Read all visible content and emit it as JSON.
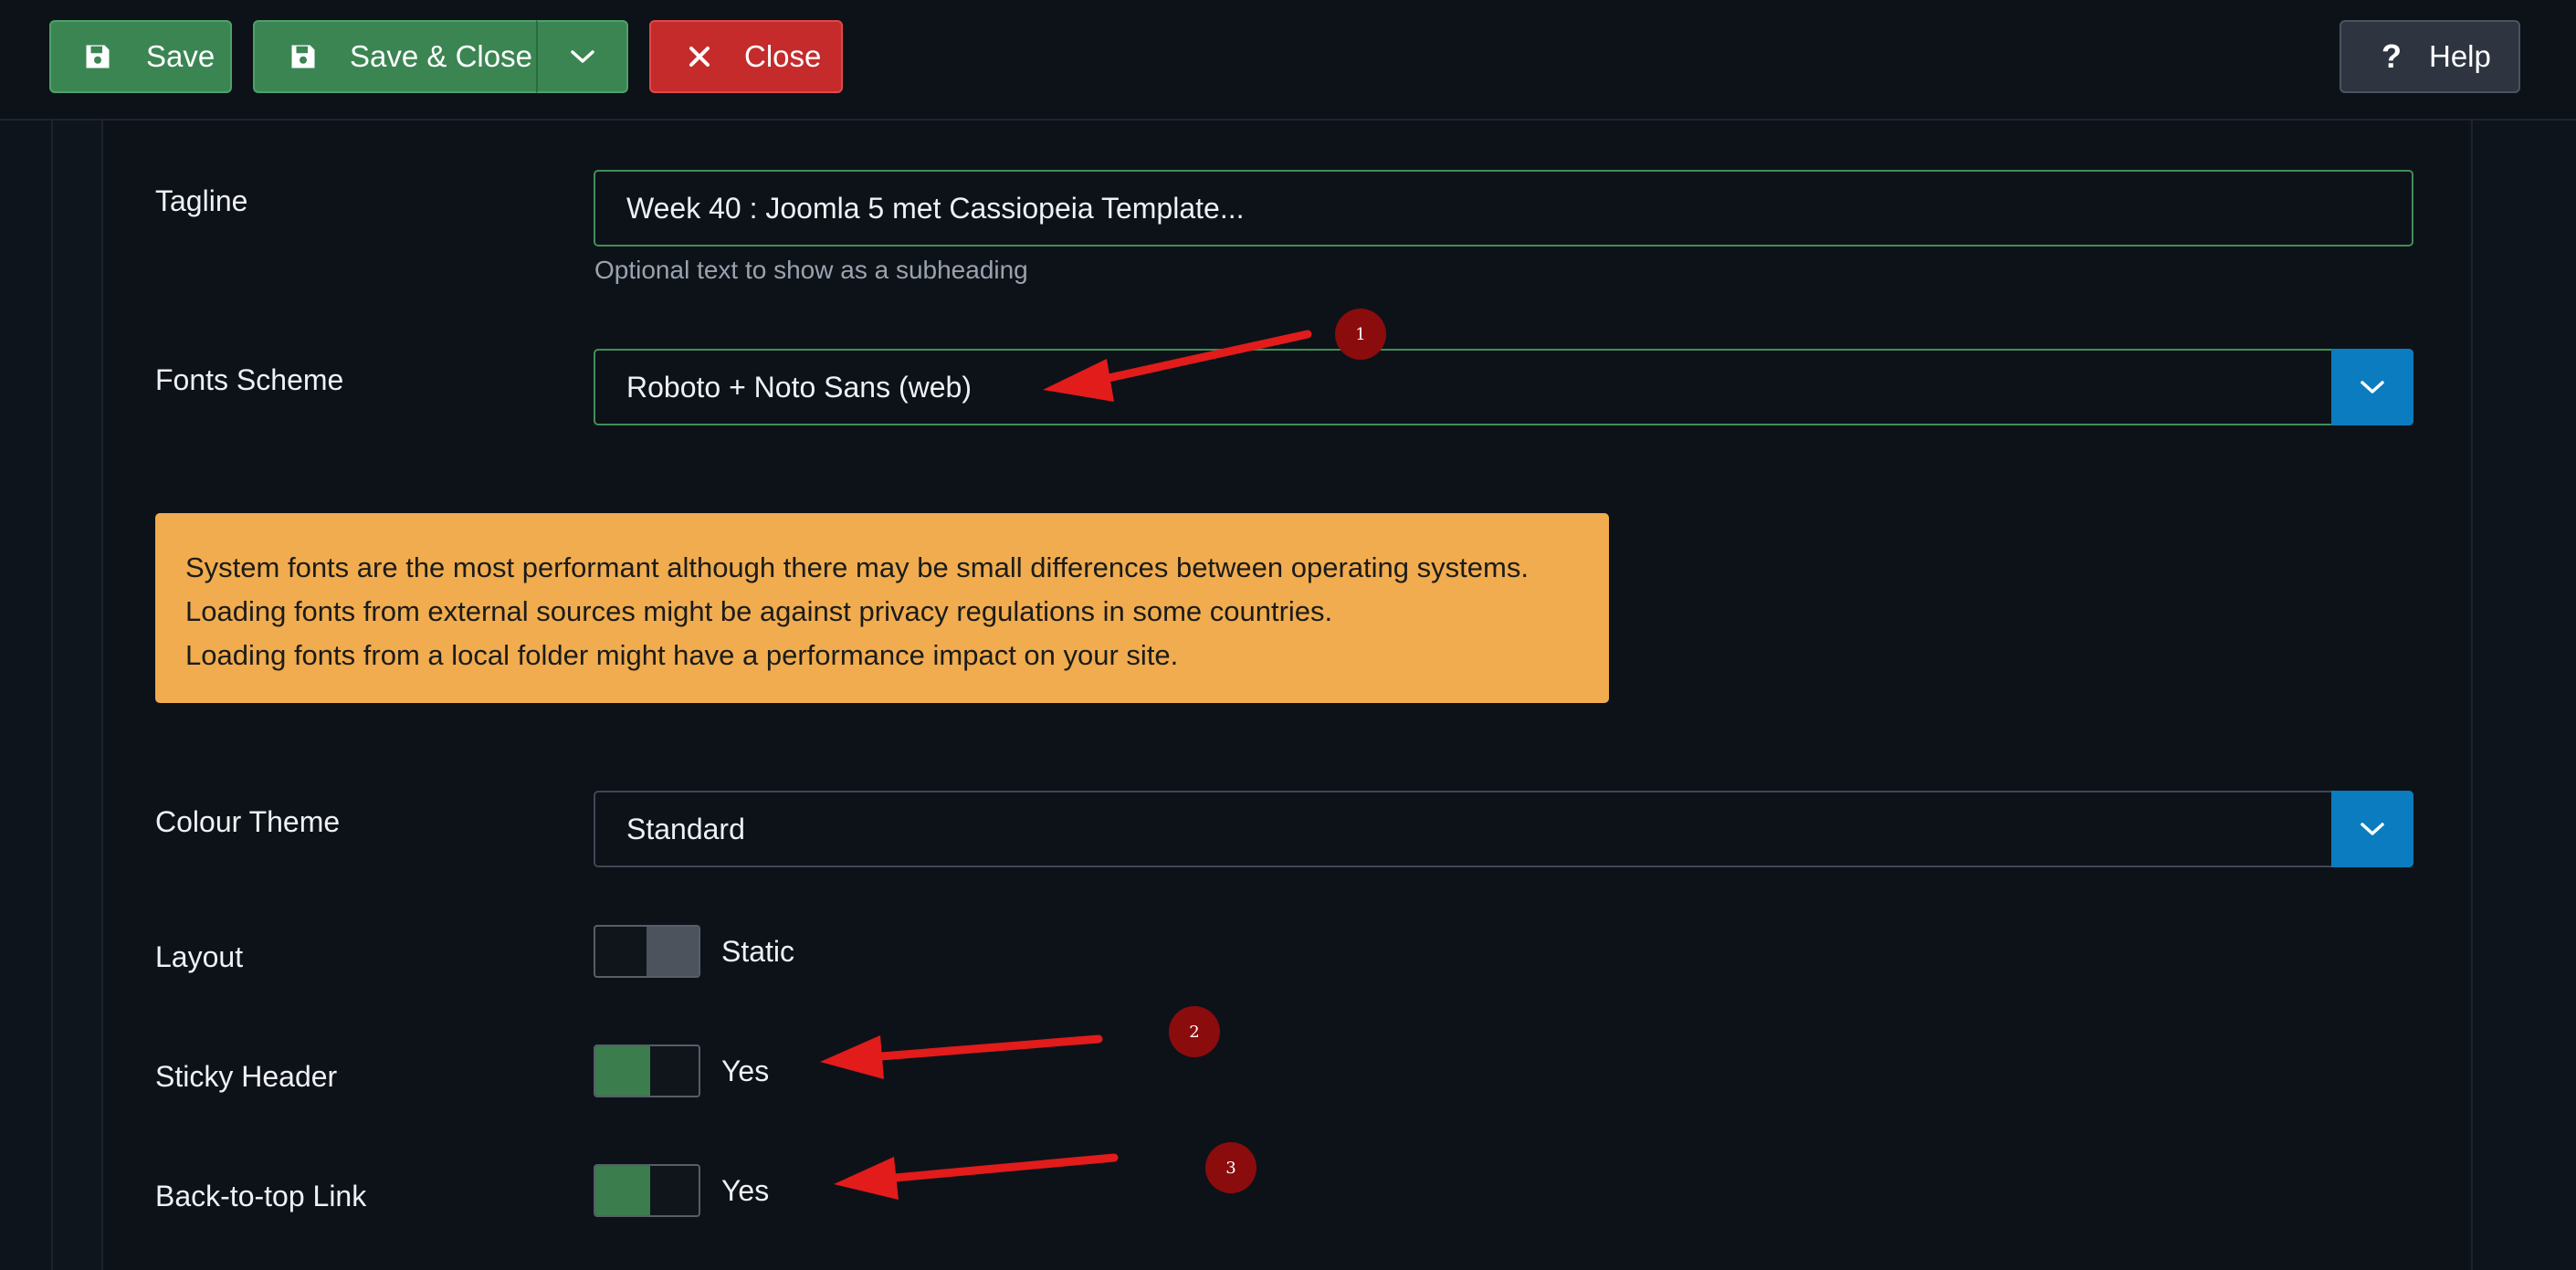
{
  "toolbar": {
    "save_label": "Save",
    "save_close_label": "Save & Close",
    "close_label": "Close",
    "help_label": "Help",
    "help_icon": "?",
    "icons": {
      "save": "floppy-disk-icon",
      "close": "x-icon",
      "dropdown": "chevron-down-icon",
      "help": "question-icon"
    }
  },
  "form": {
    "tagline": {
      "label": "Tagline",
      "value": "Week 40 : Joomla 5 met Cassiopeia Template...",
      "hint": "Optional text to show as a subheading"
    },
    "fonts_scheme": {
      "label": "Fonts Scheme",
      "value": "Roboto + Noto Sans (web)"
    },
    "fonts_alert": {
      "lines": [
        "System fonts are the most performant although there may be small differences between operating systems.",
        "Loading fonts from external sources might be against privacy regulations in some countries.",
        "Loading fonts from a local folder might have a performance impact on your site."
      ]
    },
    "colour_theme": {
      "label": "Colour Theme",
      "value": "Standard"
    },
    "layout": {
      "label": "Layout",
      "value": "Static"
    },
    "sticky_header": {
      "label": "Sticky Header",
      "value": "Yes"
    },
    "back_to_top": {
      "label": "Back-to-top Link",
      "value": "Yes"
    }
  },
  "annotations": {
    "badges": [
      "1",
      "2",
      "3"
    ]
  },
  "colors": {
    "background": "#0e141c",
    "save_green": "#3b8553",
    "close_red": "#c52b2b",
    "select_blue": "#0b7cbf",
    "alert_orange": "#f0ac4e",
    "annotation_red": "#e01010"
  }
}
